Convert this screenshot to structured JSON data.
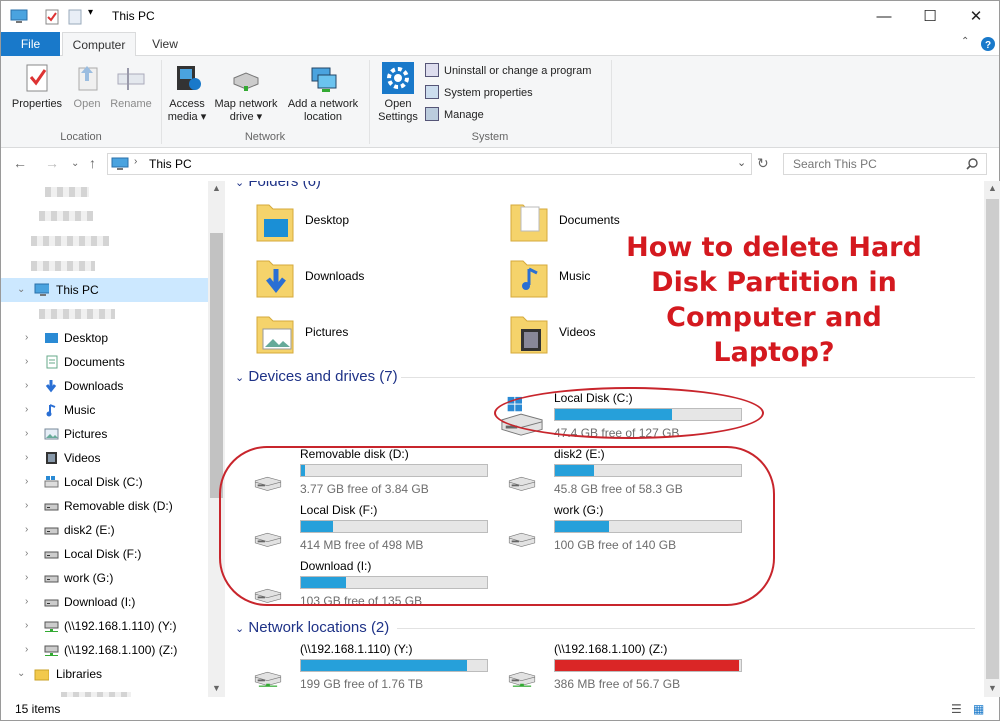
{
  "window": {
    "title": "This PC",
    "minimize_glyph": "—",
    "maximize_glyph": "☐",
    "close_glyph": "✕"
  },
  "tabs": {
    "file": "File",
    "computer": "Computer",
    "view": "View"
  },
  "ribbon": {
    "location": {
      "label": "Location",
      "properties": "Properties",
      "open": "Open",
      "rename": "Rename"
    },
    "network": {
      "label": "Network",
      "access_media": [
        "Access",
        "media ▾"
      ],
      "map_drive": [
        "Map network",
        "drive ▾"
      ],
      "add_location": [
        "Add a network",
        "location"
      ]
    },
    "system": {
      "label": "System",
      "open_settings": [
        "Open",
        "Settings"
      ],
      "uninstall": "Uninstall or change a program",
      "system_properties": "System properties",
      "manage": "Manage"
    }
  },
  "address": {
    "path": "This PC",
    "search_placeholder": "Search This PC"
  },
  "tree": {
    "this_pc": "This PC",
    "items": [
      "Desktop",
      "Documents",
      "Downloads",
      "Music",
      "Pictures",
      "Videos",
      "Local Disk (C:)",
      "Removable disk (D:)",
      "disk2 (E:)",
      "Local Disk (F:)",
      "work (G:)",
      "Download (I:)",
      "(\\\\192.168.1.110) (Y:)",
      "(\\\\192.168.1.100) (Z:)"
    ],
    "libraries": "Libraries"
  },
  "folders": {
    "heading": "Folders (6)",
    "items": [
      "Desktop",
      "Documents",
      "Downloads",
      "Music",
      "Pictures",
      "Videos"
    ]
  },
  "devices": {
    "heading": "Devices and drives (7)",
    "drives": [
      {
        "name": "Local Disk (C:)",
        "free": "47.4 GB free of 127 GB",
        "used_fraction": 0.63
      },
      {
        "name": "Removable disk (D:)",
        "free": "3.77 GB free of 3.84 GB",
        "used_fraction": 0.02
      },
      {
        "name": "disk2 (E:)",
        "free": "45.8 GB free of 58.3 GB",
        "used_fraction": 0.21
      },
      {
        "name": "Local Disk (F:)",
        "free": "414 MB free of 498 MB",
        "used_fraction": 0.17
      },
      {
        "name": "work (G:)",
        "free": "100 GB free of 140 GB",
        "used_fraction": 0.29
      },
      {
        "name": "Download (I:)",
        "free": "103 GB free of 135 GB",
        "used_fraction": 0.24
      }
    ]
  },
  "network_locations": {
    "heading": "Network locations (2)",
    "items": [
      {
        "name": "(\\\\192.168.1.110) (Y:)",
        "free": "199 GB free of 1.76 TB",
        "used_fraction": 0.89
      },
      {
        "name": "(\\\\192.168.1.100) (Z:)",
        "free": "386 MB free of 56.7 GB",
        "used_fraction": 0.99
      }
    ]
  },
  "status": {
    "items": "15 items"
  },
  "overlay": {
    "headline": [
      "How to delete Hard",
      "Disk Partition in",
      "Computer and",
      "Laptop?"
    ]
  },
  "colors": {
    "accent": "#1979ca",
    "bar": "#26a0da",
    "bar_full": "#da2626",
    "annotation": "#c8252c"
  }
}
